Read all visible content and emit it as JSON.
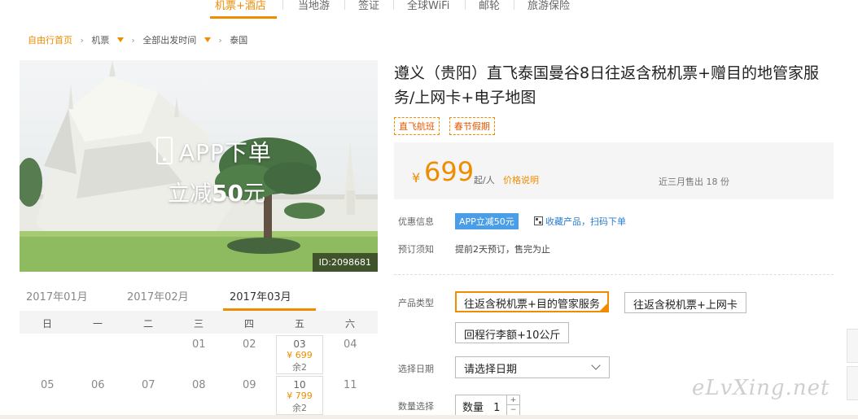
{
  "nav": {
    "items": [
      "机票+酒店",
      "当地游",
      "签证",
      "全球WiFi",
      "邮轮",
      "旅游保险"
    ],
    "active_index": 0
  },
  "breadcrumb": {
    "home": "自由行首页",
    "flight": "机票",
    "departure": "全部出发时间",
    "destination": "泰国"
  },
  "hero": {
    "app_title": "APP下单",
    "app_sub_prefix": "立减",
    "app_sub_amount": "50",
    "app_sub_suffix": "元",
    "id_tag": "ID:2098681"
  },
  "calendar": {
    "months": [
      "2017年01月",
      "2017年02月",
      "2017年03月"
    ],
    "active_month": 2,
    "weekdays": [
      "日",
      "一",
      "二",
      "三",
      "四",
      "五",
      "六"
    ],
    "days": {
      "d01": "01",
      "d02": "02",
      "d04": "04",
      "d05": "05",
      "d06": "06",
      "d07": "07",
      "d08": "08",
      "d09": "09",
      "d11": "11"
    },
    "cells": [
      {
        "date": "03",
        "price": "¥ 699",
        "remain": "余2"
      },
      {
        "date": "10",
        "price": "¥ 799",
        "remain": "余2"
      }
    ]
  },
  "product": {
    "title": "遵义（贵阳）直飞泰国曼谷8日往返含税机票+赠目的地管家服务/上网卡+电子地图",
    "tags": [
      "直飞航班",
      "春节假期"
    ],
    "currency": "¥",
    "price": "699",
    "per": "起/人",
    "price_explain": "价格说明",
    "sold": "近三月售出 18 份"
  },
  "info": {
    "discount_label": "优惠信息",
    "discount_badge": "APP立减50元",
    "collect_link": "收藏产品，扫码下单",
    "booking_label": "预订须知",
    "booking_note": "提前2天预订，售完为止"
  },
  "options": {
    "type_label": "产品类型",
    "types": [
      "往返含税机票+目的管家服务",
      "往返含税机票+上网卡",
      "回程行李额+10公斤"
    ],
    "date_label": "选择日期",
    "date_placeholder": "请选择日期",
    "qty_label": "数量选择",
    "qty_prefix": "数量",
    "qty_value": "1",
    "qty_plus": "+",
    "qty_minus": "−"
  },
  "watermark": "eLvXing.net",
  "colors": {
    "accent": "#f08c00",
    "link": "#2b7cd3",
    "badge": "#4a9ee8"
  }
}
